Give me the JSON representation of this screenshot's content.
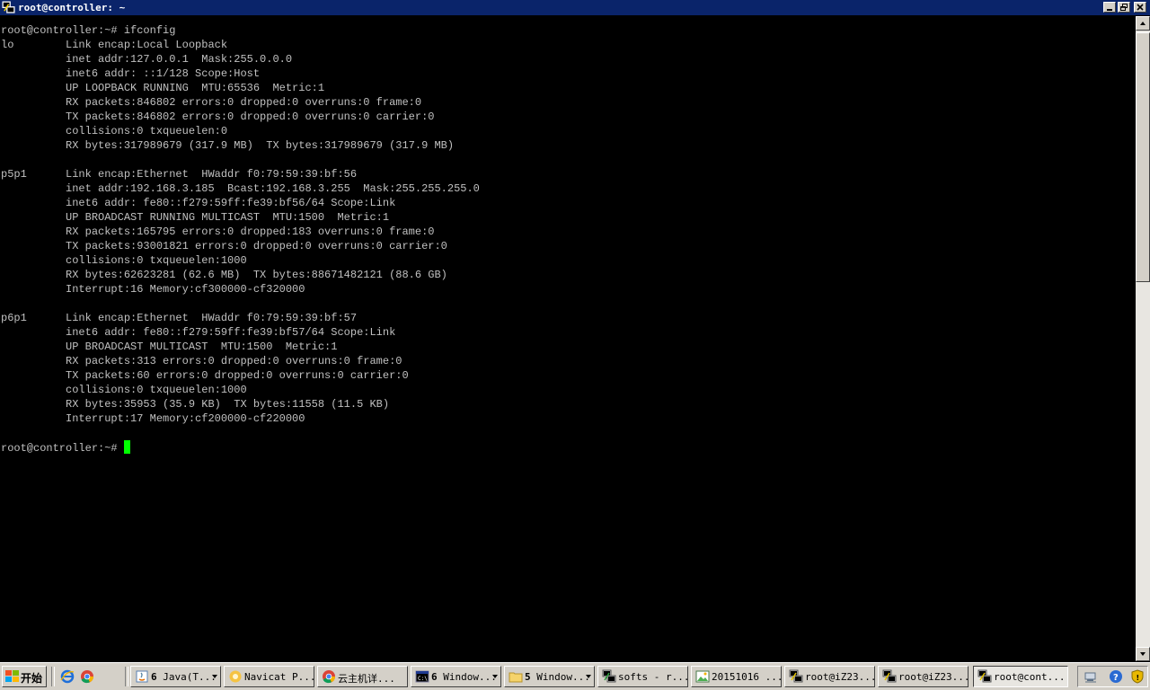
{
  "window": {
    "title": "root@controller: ~",
    "controls": [
      "minimize-icon",
      "restore-icon",
      "close-icon"
    ]
  },
  "terminal": {
    "lines": [
      "root@controller:~# ifconfig",
      "lo        Link encap:Local Loopback",
      "          inet addr:127.0.0.1  Mask:255.0.0.0",
      "          inet6 addr: ::1/128 Scope:Host",
      "          UP LOOPBACK RUNNING  MTU:65536  Metric:1",
      "          RX packets:846802 errors:0 dropped:0 overruns:0 frame:0",
      "          TX packets:846802 errors:0 dropped:0 overruns:0 carrier:0",
      "          collisions:0 txqueuelen:0",
      "          RX bytes:317989679 (317.9 MB)  TX bytes:317989679 (317.9 MB)",
      "",
      "p5p1      Link encap:Ethernet  HWaddr f0:79:59:39:bf:56",
      "          inet addr:192.168.3.185  Bcast:192.168.3.255  Mask:255.255.255.0",
      "          inet6 addr: fe80::f279:59ff:fe39:bf56/64 Scope:Link",
      "          UP BROADCAST RUNNING MULTICAST  MTU:1500  Metric:1",
      "          RX packets:165795 errors:0 dropped:183 overruns:0 frame:0",
      "          TX packets:93001821 errors:0 dropped:0 overruns:0 carrier:0",
      "          collisions:0 txqueuelen:1000",
      "          RX bytes:62623281 (62.6 MB)  TX bytes:88671482121 (88.6 GB)",
      "          Interrupt:16 Memory:cf300000-cf320000",
      "",
      "p6p1      Link encap:Ethernet  HWaddr f0:79:59:39:bf:57",
      "          inet6 addr: fe80::f279:59ff:fe39:bf57/64 Scope:Link",
      "          UP BROADCAST MULTICAST  MTU:1500  Metric:1",
      "          RX packets:313 errors:0 dropped:0 overruns:0 frame:0",
      "          TX packets:60 errors:0 dropped:0 overruns:0 carrier:0",
      "          collisions:0 txqueuelen:1000",
      "          RX bytes:35953 (35.9 KB)  TX bytes:11558 (11.5 KB)",
      "          Interrupt:17 Memory:cf200000-cf220000",
      ""
    ],
    "prompt": "root@controller:~# ",
    "colors": {
      "background": "#000000",
      "text": "#c0c0c0",
      "cursor": "#00ff00"
    }
  },
  "taskbar": {
    "start_label": "开始",
    "quick_launch": [
      "ie-icon",
      "chrome-icon"
    ],
    "tasks": [
      {
        "count": "6",
        "label": "Java(T...",
        "icon": "java-icon",
        "grouped": true
      },
      {
        "label": "Navicat P...",
        "icon": "navicat-icon",
        "grouped": false
      },
      {
        "label": "云主机详...",
        "icon": "chrome-icon",
        "grouped": false
      },
      {
        "count": "6",
        "label": "Window...",
        "icon": "cmd-icon",
        "grouped": true
      },
      {
        "count": "5",
        "label": "Window...",
        "icon": "folder-icon",
        "grouped": true
      },
      {
        "label": "softs - r...",
        "icon": "putty-icon",
        "grouped": false
      },
      {
        "label": "20151016 ...",
        "icon": "image-icon",
        "grouped": false
      },
      {
        "label": "root@iZ23...",
        "icon": "putty-icon",
        "grouped": false
      },
      {
        "label": "root@iZ23...",
        "icon": "putty-icon",
        "grouped": false
      },
      {
        "label": "root@cont...",
        "icon": "putty-icon",
        "grouped": false,
        "active": true
      }
    ],
    "tray": [
      "network-icon",
      "help-icon",
      "shield-icon"
    ]
  }
}
